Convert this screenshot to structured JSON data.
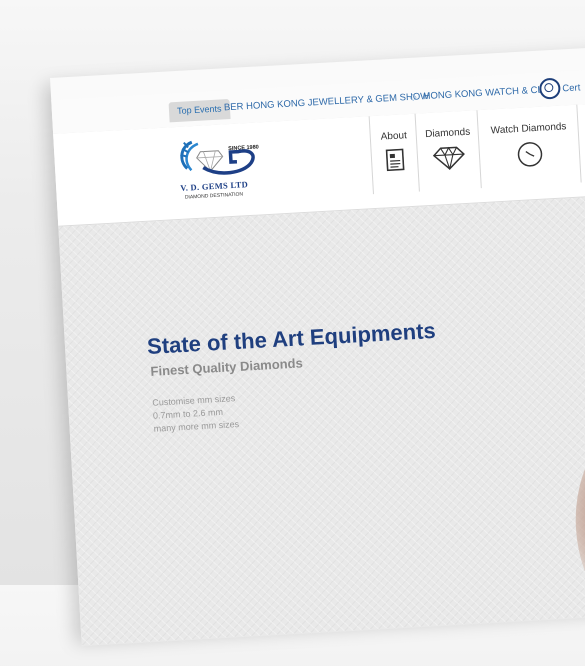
{
  "ticker": {
    "tab_label": "Top Events",
    "event_1": "BER HONG KONG JEWELLERY & GEM SHOW",
    "event_2": "HONG KONG WATCH & CLOC",
    "cert_label": "Cert",
    "gem_icon": "diamond-icon",
    "cert_icon": "certificate-icon"
  },
  "logo": {
    "since": "SINCE 1980",
    "name": "V. D. GEMS LTD",
    "tagline": "DIAMOND DESTINATION"
  },
  "nav": {
    "items": [
      {
        "label": "About",
        "icon": "document-icon"
      },
      {
        "label": "Diamonds",
        "icon": "diamond-icon"
      },
      {
        "label": "Watch Diamonds",
        "icon": "clock-icon"
      }
    ]
  },
  "hero": {
    "title": "State of the Art Equipments",
    "subtitle": "Finest Quality Diamonds",
    "lines": [
      "Customise mm sizes",
      "0.7mm to 2.6 mm",
      "many more mm sizes"
    ]
  },
  "colors": {
    "brand_blue": "#1f3f7f",
    "link_blue": "#2f6aa9",
    "muted_gray": "#9a9a9a"
  }
}
